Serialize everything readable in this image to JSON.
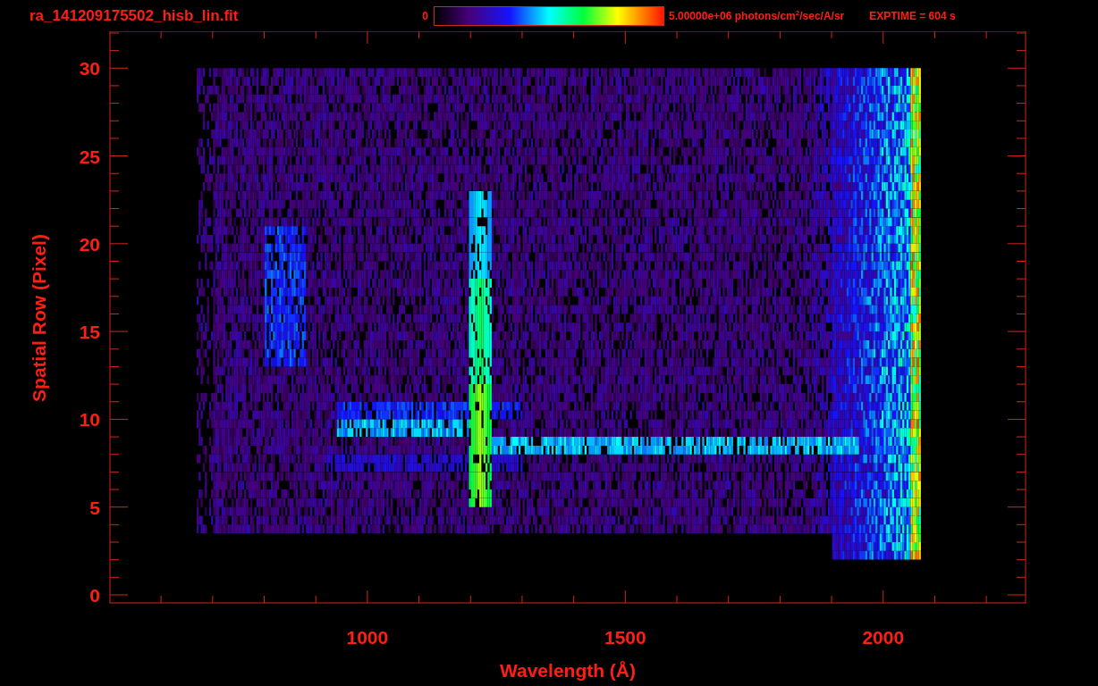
{
  "header": {
    "title": "ra_141209175502_hisb_lin.fit",
    "colorbar": {
      "min_label": "0",
      "max_label": "5.00000e+06 photons/cm$^{2}$/sec/A/sr"
    },
    "exposure": "EXPTIME = 604 s"
  },
  "plot": {
    "xlabel": "Wavelength (Å)",
    "ylabel": "Spatial Row (Pixel)",
    "xtick_labels": [
      "1000",
      "1500",
      "2000"
    ],
    "ytick_labels": [
      "30",
      "25",
      "20",
      "15",
      "10",
      "5",
      "0"
    ]
  }
}
